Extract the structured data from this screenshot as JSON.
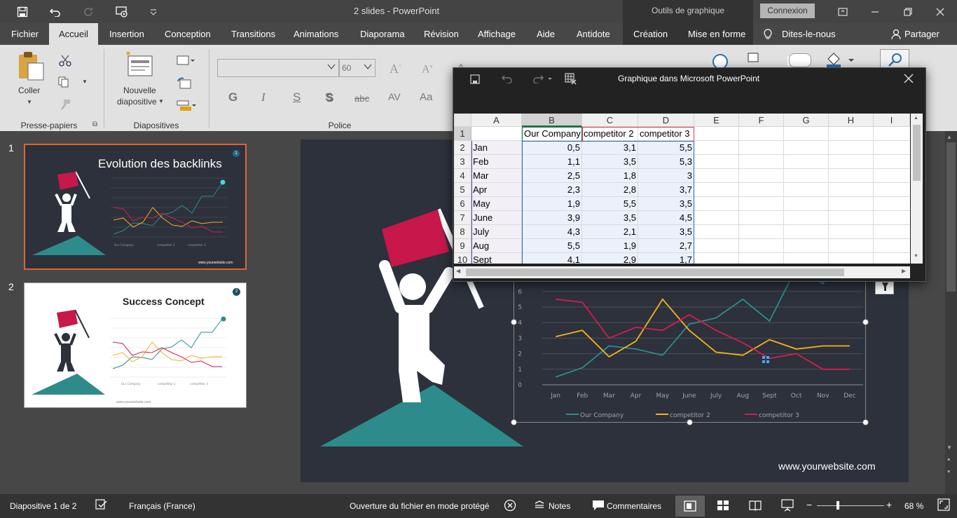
{
  "window": {
    "title": "2 slides  -  PowerPoint",
    "context_title": "Outils de graphique",
    "signin": "Connexion"
  },
  "tabs": [
    "Fichier",
    "Accueil",
    "Insertion",
    "Conception",
    "Transitions",
    "Animations",
    "Diaporama",
    "Révision",
    "Affichage",
    "Aide",
    "Antidote",
    "Création",
    "Mise en forme"
  ],
  "tellme": "Dites-le-nous",
  "share": "Partager",
  "ribbon": {
    "paste_label": "Coller",
    "new_slide_label": "Nouvelle",
    "new_slide_label2": "diapositive",
    "font_size": "60",
    "group_clipboard": "Presse-papiers",
    "group_slides": "Diapositives",
    "group_font": "Police"
  },
  "thumbnails": [
    {
      "number": "1",
      "title": "Evolution des backlinks",
      "website": "www.yourwebsite.com",
      "badge": "1"
    },
    {
      "number": "2",
      "title": "Success Concept",
      "website": "www.yourwebsite.com",
      "badge": "2"
    }
  ],
  "slide": {
    "website": "www.yourwebsite.com"
  },
  "datasheet": {
    "title": "Graphique dans Microsoft PowerPoint",
    "columns": [
      "A",
      "B",
      "C",
      "D",
      "E",
      "F",
      "G",
      "H",
      "I"
    ],
    "header_row": [
      "",
      "Our Company",
      "competitor 2",
      "competitor 3"
    ],
    "rows": [
      {
        "n": "2",
        "label": "Jan",
        "b": "0,5",
        "c": "3,1",
        "d": "5,5"
      },
      {
        "n": "3",
        "label": "Feb",
        "b": "1,1",
        "c": "3,5",
        "d": "5,3"
      },
      {
        "n": "4",
        "label": "Mar",
        "b": "2,5",
        "c": "1,8",
        "d": "3"
      },
      {
        "n": "5",
        "label": "Apr",
        "b": "2,3",
        "c": "2,8",
        "d": "3,7"
      },
      {
        "n": "6",
        "label": "May",
        "b": "1,9",
        "c": "5,5",
        "d": "3,5"
      },
      {
        "n": "7",
        "label": "June",
        "b": "3,9",
        "c": "3,5",
        "d": "4,5"
      },
      {
        "n": "8",
        "label": "July",
        "b": "4,3",
        "c": "2,1",
        "d": "3,5"
      },
      {
        "n": "9",
        "label": "Aug",
        "b": "5,5",
        "c": "1,9",
        "d": "2,7"
      },
      {
        "n": "10",
        "label": "Sept",
        "b": "4,1",
        "c": "2,9",
        "d": "1,7"
      }
    ]
  },
  "chart_data": {
    "type": "line",
    "categories": [
      "Jan",
      "Feb",
      "Mar",
      "Apr",
      "May",
      "June",
      "July",
      "Aug",
      "Sept",
      "Oct",
      "Nov",
      "Dec"
    ],
    "y_ticks": [
      "0",
      "1",
      "2",
      "3",
      "4",
      "5",
      "6"
    ],
    "x_tick_labels": [
      "Jan",
      "Feb",
      "Mar",
      "Apr",
      "May",
      "June",
      "July",
      "Aug",
      "Sept",
      "Oct",
      "Nov",
      "Dec"
    ],
    "ylim": [
      0,
      7
    ],
    "series": [
      {
        "name": "Our Company",
        "color": "#2e8b8b",
        "values": [
          0.5,
          1.1,
          2.5,
          2.3,
          1.9,
          3.9,
          4.3,
          5.5,
          4.1,
          7.5,
          6.5,
          9.5
        ]
      },
      {
        "name": "competitor 2",
        "color": "#f5b21f",
        "values": [
          3.1,
          3.5,
          1.8,
          2.8,
          5.5,
          3.5,
          2.1,
          1.9,
          2.9,
          2.3,
          2.5,
          2.5
        ]
      },
      {
        "name": "competitor 3",
        "color": "#d81b4f",
        "values": [
          5.5,
          5.3,
          3.0,
          3.7,
          3.5,
          4.5,
          3.5,
          2.7,
          1.7,
          2.0,
          1.0,
          1.0
        ]
      }
    ],
    "legend_position": "bottom",
    "grid": true
  },
  "status": {
    "slide_info": "Diapositive 1 de 2",
    "language": "Français (France)",
    "protected": "Ouverture du fichier en mode protégé",
    "notes": "Notes",
    "comments": "Commentaires",
    "zoom": "68 %"
  },
  "colors": {
    "accent": "#b7472a",
    "teal": "#2e8b8b",
    "flag": "#c8174a",
    "slide_bg": "#2c313b"
  }
}
